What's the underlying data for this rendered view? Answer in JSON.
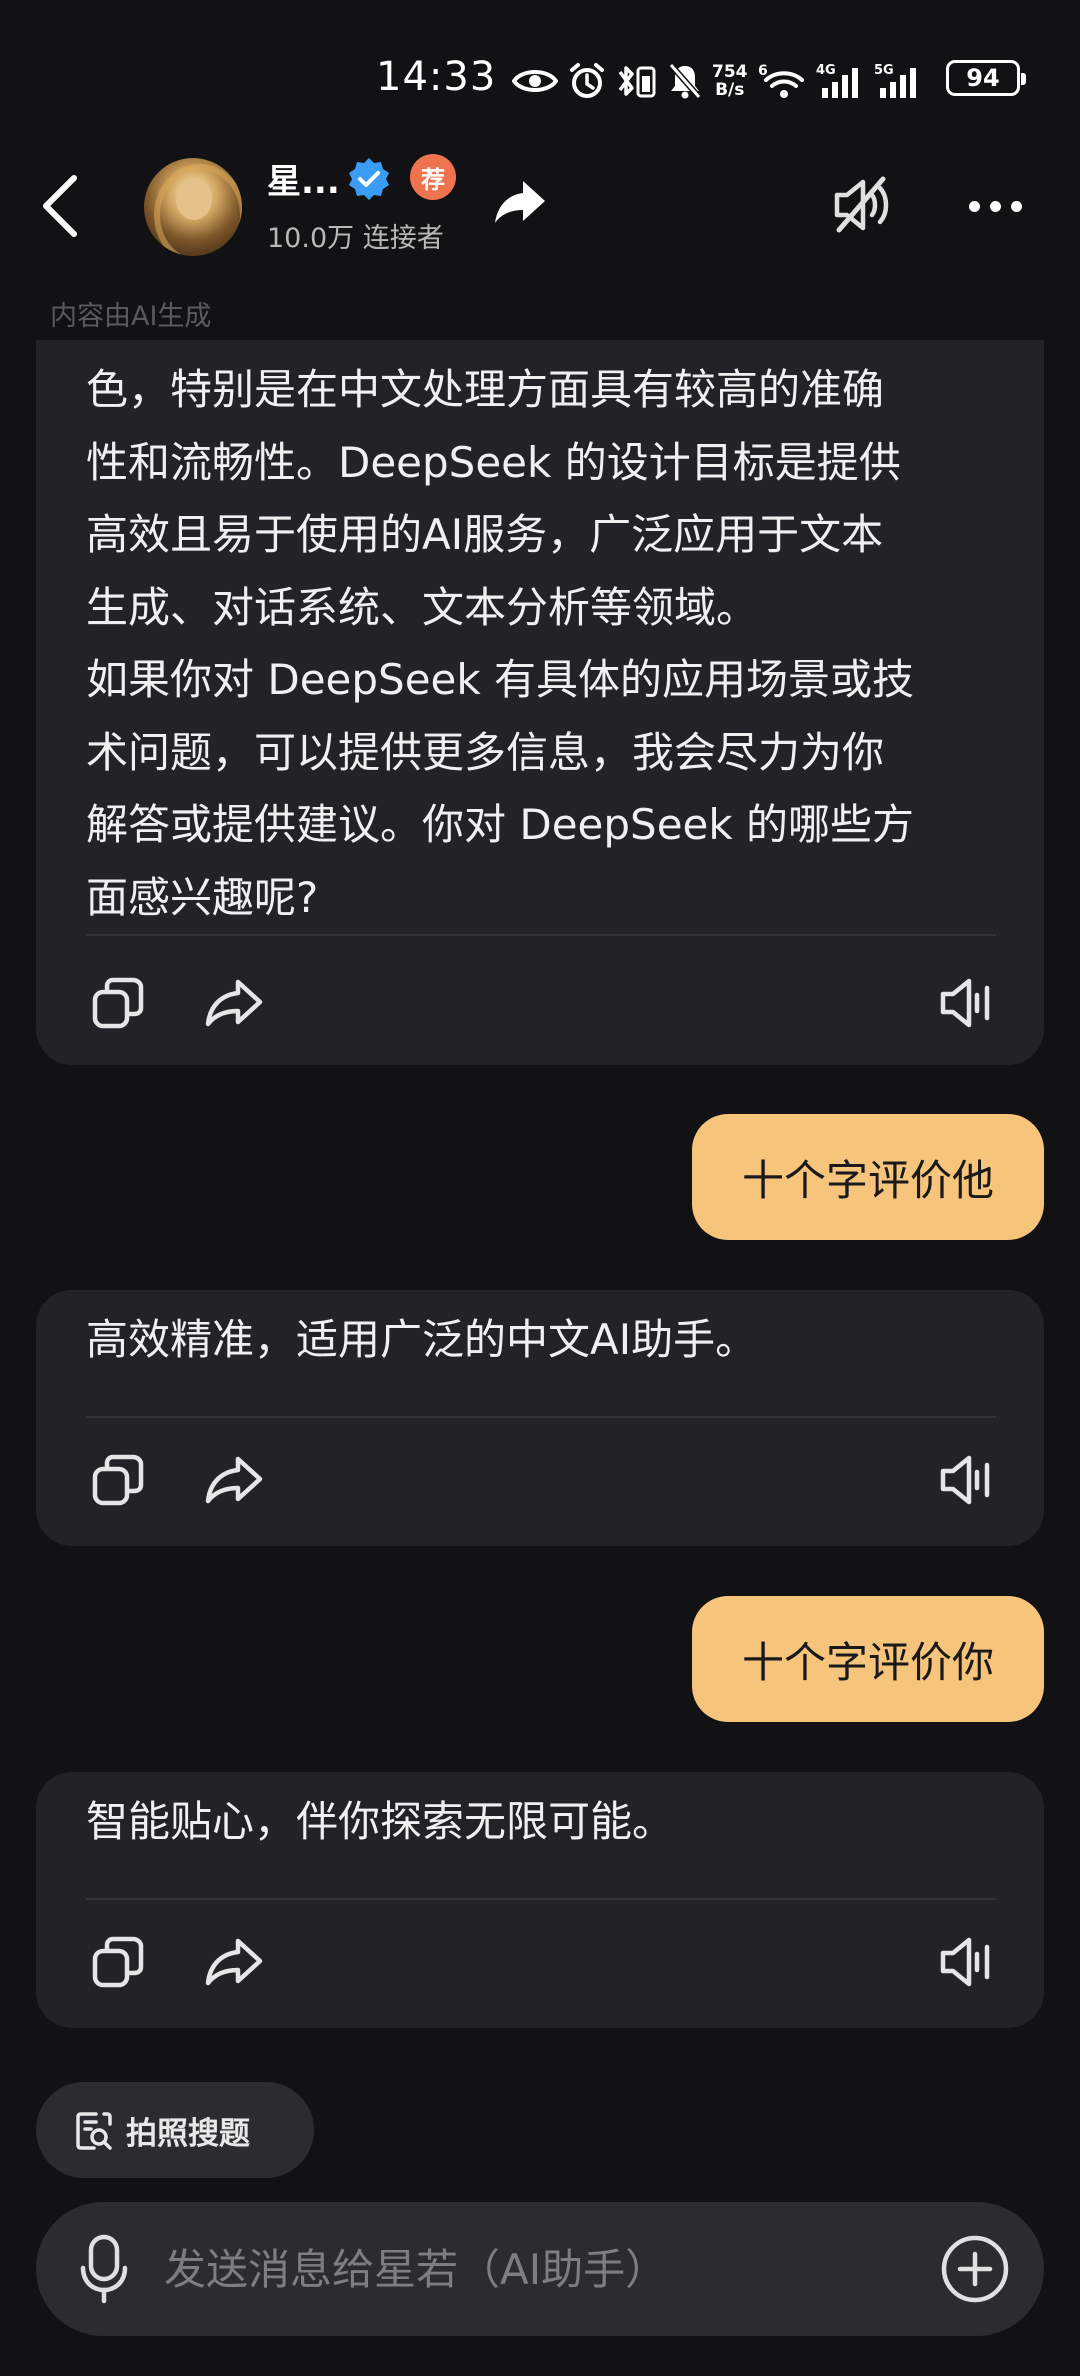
{
  "status_bar": {
    "time": "14:33",
    "net_speed_value": "754",
    "net_speed_unit": "B/s",
    "network_4g": "4G",
    "network_5g": "5G",
    "wifi_tag": "6",
    "battery": "94"
  },
  "header": {
    "name": "星...",
    "rec_badge": "荐",
    "subtitle": "10.0万 连接者",
    "ai_notice": "内容由AI生成"
  },
  "messages": [
    {
      "role": "assistant",
      "text": "色，特别是在中文处理方面具有较高的准确\n性和流畅性。DeepSeek 的设计目标是提供\n高效且易于使用的AI服务，广泛应用于文本\n生成、对话系统、文本分析等领域。\n如果你对 DeepSeek 有具体的应用场景或技\n术问题，可以提供更多信息，我会尽力为你\n解答或提供建议。你对 DeepSeek 的哪些方\n面感兴趣呢?"
    },
    {
      "role": "user",
      "text": "十个字评价他"
    },
    {
      "role": "assistant",
      "text": "高效精准，适用广泛的中文AI助手。"
    },
    {
      "role": "user",
      "text": "十个字评价你"
    },
    {
      "role": "assistant",
      "text": "智能贴心，伴你探索无限可能。"
    }
  ],
  "bottom": {
    "photo_search_label": "拍照搜题",
    "input_placeholder": "发送消息给星若（AI助手）"
  },
  "colors": {
    "background": "#121214",
    "ai_bubble": "#232327",
    "user_bubble": "#f7c47c",
    "verified": "#3a9cf5",
    "rec_badge": "#f0734f"
  },
  "icons": {
    "back": "chevron-left-icon",
    "verified": "verified-badge-icon",
    "share": "share-arrow-icon",
    "mute": "speaker-muted-icon",
    "more": "more-horizontal-icon",
    "copy": "copy-icon",
    "forward": "share-icon",
    "speaker": "speaker-icon",
    "photo_search": "photo-search-icon",
    "mic": "microphone-icon",
    "add": "plus-circle-icon"
  }
}
